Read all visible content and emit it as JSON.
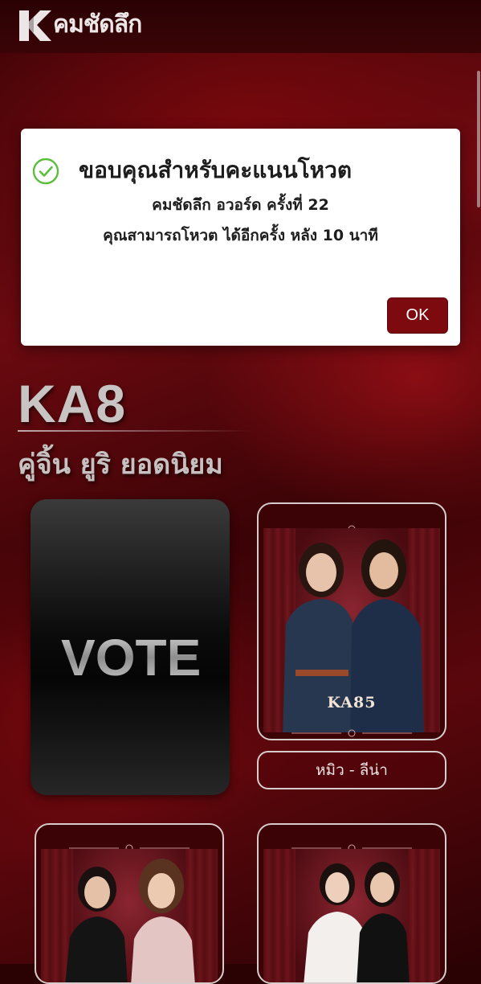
{
  "header": {
    "logo_text": "คมชัดลึก",
    "logo_icon": "k-letter-logo"
  },
  "modal": {
    "icon": "check-circle-icon",
    "title": "ขอบคุณสำหรับคะแนนโหวต",
    "line1": "คมชัดลึก อวอร์ด ครั้งที่ 22",
    "line2": "คุณสามารถโหวต ได้อีกครั้ง หลัง 10 นาที",
    "ok_label": "OK"
  },
  "section": {
    "code": "KA8",
    "subtitle": "คู่จิ้น ยูริ ยอดนิยม"
  },
  "vote_card": {
    "logo_text": "VOTE"
  },
  "candidates": [
    {
      "code": "KA85",
      "name": "หมิว - ลีน่า"
    }
  ],
  "colors": {
    "accent": "#7c0a0f",
    "check_green": "#5bbf3c"
  }
}
